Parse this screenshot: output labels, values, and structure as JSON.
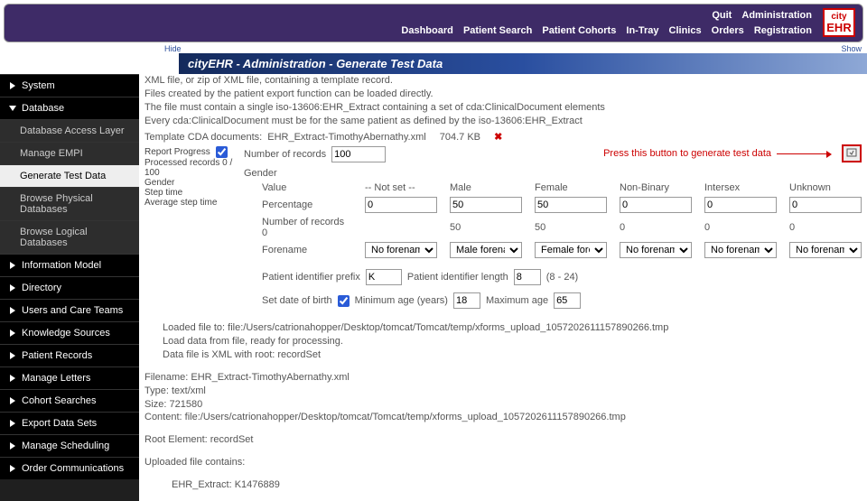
{
  "top": {
    "row1": {
      "quit": "Quit",
      "admin": "Administration"
    },
    "row2": {
      "dashboard": "Dashboard",
      "patientSearch": "Patient Search",
      "patientCohorts": "Patient Cohorts",
      "inTray": "In-Tray",
      "clinics": "Clinics",
      "orders": "Orders",
      "registration": "Registration"
    },
    "logo1": "city",
    "logo2": "EHR"
  },
  "sub": {
    "hide": "Hide",
    "show": "Show"
  },
  "title": "cityEHR - Administration - Generate Test Data",
  "sidebar": {
    "system": "System",
    "database": "Database",
    "db": {
      "accessLayer": "Database Access Layer",
      "manageEMPI": "Manage EMPI",
      "generateTest": "Generate Test Data",
      "browsePhysical": "Browse Physical Databases",
      "browseLogical": "Browse Logical Databases"
    },
    "infoModel": "Information Model",
    "directory": "Directory",
    "usersCare": "Users and Care Teams",
    "knowledge": "Knowledge Sources",
    "patientRecords": "Patient Records",
    "manageLetters": "Manage Letters",
    "cohortSearches": "Cohort Searches",
    "exportDataSets": "Export Data Sets",
    "manageScheduling": "Manage Scheduling",
    "orderComm": "Order Communications"
  },
  "main": {
    "intro1": "XML file, or zip of XML file, containing a template record.",
    "intro2": "Files created by the patient export function can be loaded directly.",
    "intro3": "The file must contain a single iso-13606:EHR_Extract containing a set of cda:ClinicalDocument elements",
    "intro4": "Every cda:ClinicalDocument must be for the same patient as defined by the iso-13606:EHR_Extract",
    "templateLabel": "Template CDA documents:",
    "templateFile": "EHR_Extract-TimothyAbernathy.xml",
    "templateSize": "704.7 KB",
    "reportProgressLabel": "Report Progress",
    "numRecordsLabel": "Number of records",
    "numRecordsVal": "100",
    "processed": "Processed records 0 / 100",
    "genderLeft": "Gender",
    "stepTime": "Step time",
    "avgStepTime": "Average step time",
    "annot": "Press this button to generate test data",
    "genderHdr": "Gender",
    "col": {
      "value": "Value",
      "notset": "-- Not set --",
      "male": "Male",
      "female": "Female",
      "nonBinary": "Non-Binary",
      "intersex": "Intersex",
      "unknown": "Unknown",
      "percentage": "Percentage",
      "numRecords": "Number of records",
      "forename": "Forename"
    },
    "pct": {
      "notset": "0",
      "male": "50",
      "female": "50",
      "nonBinary": "0",
      "intersex": "0",
      "unknown": "0"
    },
    "rec": {
      "total": "0",
      "notset": "",
      "male": "50",
      "female": "50",
      "nonBinary": "0",
      "intersex": "0",
      "unknown": "0"
    },
    "sel": {
      "notset": "No forename",
      "male": "Male forename",
      "female": "Female forename",
      "nonBinary": "No forename",
      "intersex": "No forename",
      "unknown": "No forename"
    },
    "pidPrefixLabel": "Patient identifier prefix",
    "pidPrefixVal": "K",
    "pidLenLabel": "Patient identifier length",
    "pidLenVal": "8",
    "pidLenRange": "(8 - 24)",
    "setDobLabel": "Set date of birth",
    "minAgeLabel": "Minimum age (years)",
    "minAgeVal": "18",
    "maxAgeLabel": "Maximum age",
    "maxAgeVal": "65",
    "file": {
      "l1": "Loaded file to: file:/Users/catrionahopper/Desktop/tomcat/Tomcat/temp/xforms_upload_1057202611157890266.tmp",
      "l2": "Load data from file, ready for processing.",
      "l3": "Data file is XML with root: recordSet",
      "filenameLabel": "Filename:",
      "filenameVal": "EHR_Extract-TimothyAbernathy.xml",
      "typeLabel": "Type:",
      "typeVal": "text/xml",
      "sizeLabel": "Size:",
      "sizeVal": "721580",
      "contentLabel": "Content:",
      "contentVal": "file:/Users/catrionahopper/Desktop/tomcat/Tomcat/temp/xforms_upload_1057202611157890266.tmp",
      "rootLabel": "Root Element:",
      "rootVal": "recordSet",
      "uplContains": "Uploaded file contains:",
      "extractLabel": "EHR_Extract:",
      "extractVal": "K1476889"
    }
  }
}
